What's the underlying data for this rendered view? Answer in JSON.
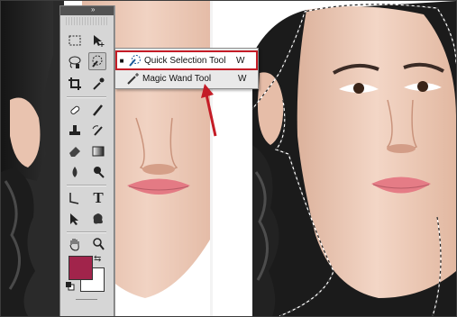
{
  "toolbar": {
    "collapse_glyph": "»",
    "tools": [
      {
        "name": "rectangular-marquee-icon"
      },
      {
        "name": "move-icon"
      },
      {
        "name": "lasso-icon"
      },
      {
        "name": "quick-selection-icon",
        "active": true
      },
      {
        "name": "crop-icon"
      },
      {
        "name": "eyedropper-icon"
      },
      {
        "name": "healing-brush-icon"
      },
      {
        "name": "brush-icon"
      },
      {
        "name": "clone-stamp-icon"
      },
      {
        "name": "history-brush-icon"
      },
      {
        "name": "eraser-icon"
      },
      {
        "name": "gradient-icon"
      },
      {
        "name": "blur-icon"
      },
      {
        "name": "dodge-icon"
      },
      {
        "name": "pen-icon"
      },
      {
        "name": "type-icon",
        "glyph": "T"
      },
      {
        "name": "path-selection-icon"
      },
      {
        "name": "custom-shape-icon"
      },
      {
        "name": "hand-icon"
      },
      {
        "name": "zoom-icon"
      }
    ],
    "foreground_color": "#a1244b",
    "background_color": "#ffffff"
  },
  "flyout": {
    "items": [
      {
        "label": "Quick Selection Tool",
        "shortcut": "W",
        "selected": true,
        "icon": "quick-selection-icon"
      },
      {
        "label": "Magic Wand Tool",
        "shortcut": "W",
        "selected": false,
        "icon": "magic-wand-icon"
      }
    ],
    "highlight_color": "#c41c26"
  }
}
